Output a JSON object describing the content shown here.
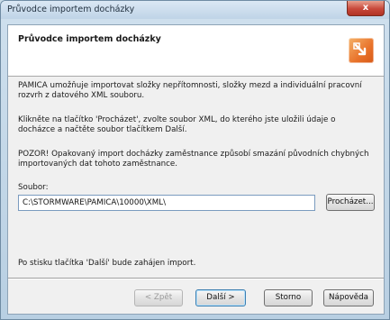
{
  "window": {
    "title": "Průvodce importem docházky",
    "close_glyph": "x"
  },
  "header": {
    "title": "Průvodce importem docházky",
    "logo_icon": "pamica-logo-icon"
  },
  "body": {
    "paragraph1": "PAMICA umožňuje importovat složky nepřítomnosti, složky mezd a individuální pracovní rozvrh z datového XML souboru.",
    "paragraph2": "Klikněte na tlačítko 'Procházet', zvolte soubor XML, do kterého jste uložili údaje o docházce a načtěte soubor tlačítkem Další.",
    "paragraph3": "POZOR! Opakovaný import docházky zaměstnance způsobí smazání původních chybných importovaných dat tohoto zaměstnance.",
    "soubor_label": "Soubor:",
    "file_path": "C:\\STORMWARE\\PAMICA\\10000\\XML\\",
    "browse_label": "Procházet...",
    "note": "Po stisku tlačítka 'Další' bude zahájen import."
  },
  "footer": {
    "back_label": "< Zpět",
    "next_label": "Další >",
    "cancel_label": "Storno",
    "help_label": "Nápověda"
  }
}
